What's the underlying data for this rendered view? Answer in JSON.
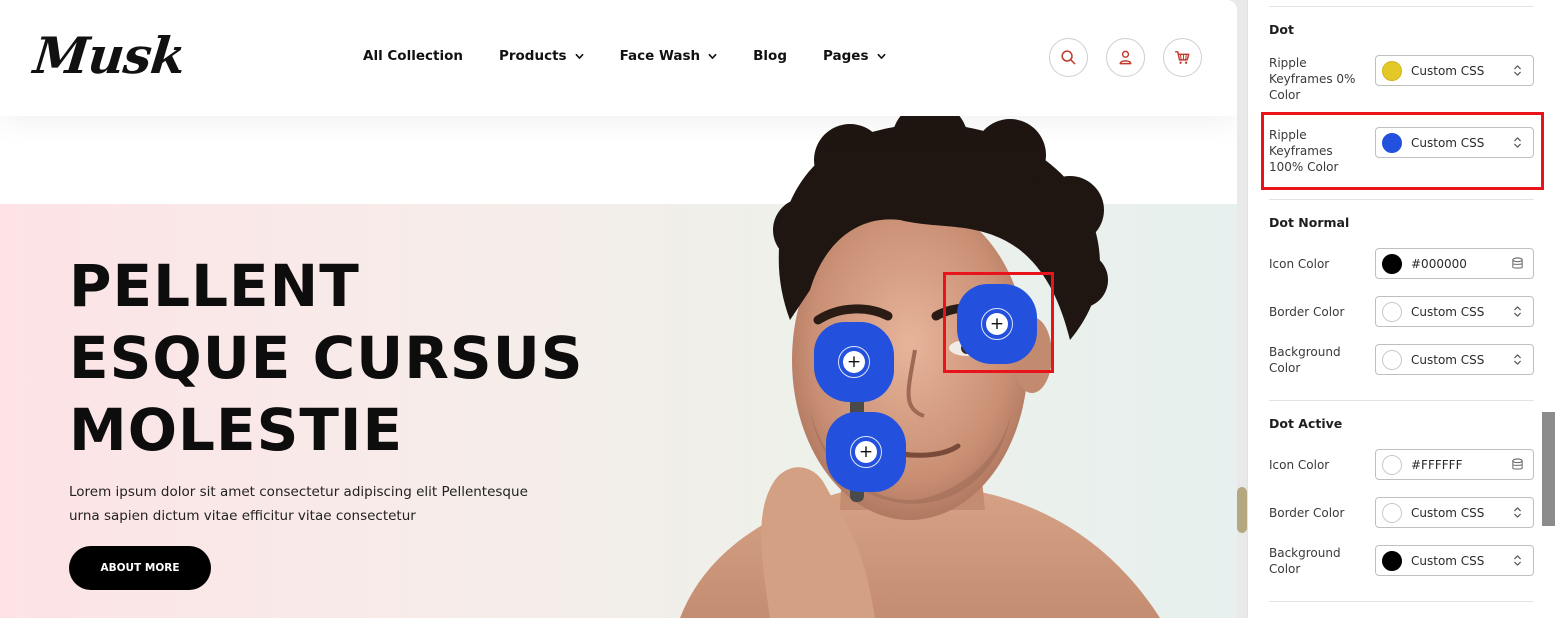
{
  "site": {
    "logo": "Musk",
    "nav": [
      {
        "label": "All Collection",
        "has_dropdown": false
      },
      {
        "label": "Products",
        "has_dropdown": true
      },
      {
        "label": "Face Wash",
        "has_dropdown": true
      },
      {
        "label": "Blog",
        "has_dropdown": false
      },
      {
        "label": "Pages",
        "has_dropdown": true
      }
    ],
    "header_icons": [
      "search-icon",
      "user-icon",
      "cart-icon"
    ],
    "icon_accent_color": "#c0392b"
  },
  "hero": {
    "title_lines": [
      "PELLENT",
      "ESQUE CURSUS",
      "MOLESTIE"
    ],
    "description_lines": [
      "Lorem ipsum dolor sit amet consectetur adipiscing elit Pellentesque",
      "urna sapien dictum vitae efficitur vitae consectetur"
    ],
    "button_label": "ABOUT MORE",
    "hotspot_symbol": "+",
    "hotspot_color": "#2351de"
  },
  "panel": {
    "sections": {
      "dot": {
        "title": "Dot",
        "ripple0": {
          "label": "Ripple Keyframes 0% Color",
          "value": "Custom CSS",
          "swatch": "#e3c826"
        },
        "ripple100": {
          "label": "Ripple Keyframes 100% Color",
          "value": "Custom CSS",
          "swatch": "#2351de"
        }
      },
      "dot_normal": {
        "title": "Dot Normal",
        "icon_color": {
          "label": "Icon Color",
          "value": "#000000",
          "swatch": "#000000"
        },
        "border_color": {
          "label": "Border Color",
          "value": "Custom CSS",
          "swatch": "#ffffff"
        },
        "background_color": {
          "label": "Background Color",
          "value": "Custom CSS",
          "swatch": "#ffffff"
        }
      },
      "dot_active": {
        "title": "Dot Active",
        "icon_color": {
          "label": "Icon Color",
          "value": "#FFFFFF",
          "swatch": "#ffffff"
        },
        "border_color": {
          "label": "Border Color",
          "value": "Custom CSS",
          "swatch": "#ffffff"
        },
        "background_color": {
          "label": "Background Color",
          "value": "Custom CSS",
          "swatch": "#000000"
        }
      }
    },
    "highlight_color": "#e8131b"
  }
}
